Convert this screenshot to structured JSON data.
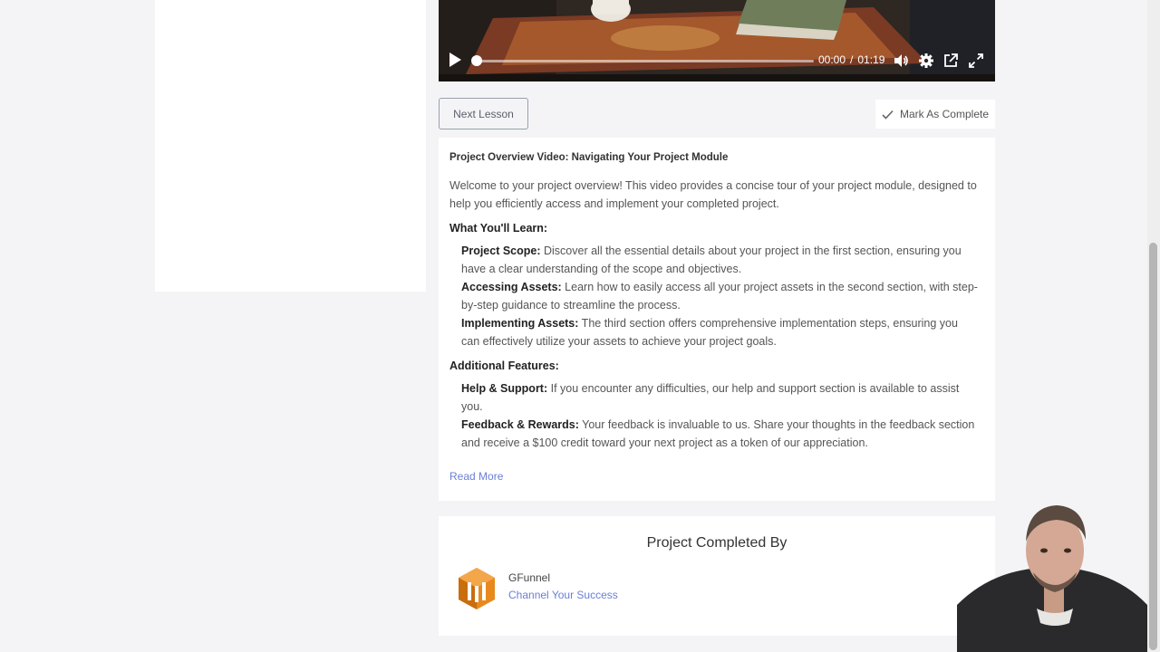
{
  "video": {
    "current_time": "00:00",
    "separator": "/",
    "duration": "01:19",
    "progress_fraction": 0.0
  },
  "lesson_nav": {
    "next_label": "Next Lesson",
    "complete_label": "Mark As Complete"
  },
  "description": {
    "title": "Project Overview Video: Navigating Your Project Module",
    "intro": "Welcome to your project overview! This video provides a concise tour of your project module, designed to help you efficiently access and implement your completed project.",
    "learn_heading": "What You'll Learn:",
    "learn_items": [
      {
        "label": "Project Scope:",
        "text": " Discover all the essential details about your project in the first section, ensuring you have a clear understanding of the scope and objectives."
      },
      {
        "label": "Accessing Assets:",
        "text": " Learn how to easily access all your project assets in the second section, with step-by-step guidance to streamline the process."
      },
      {
        "label": "Implementing Assets:",
        "text": " The third section offers comprehensive implementation steps, ensuring you can effectively utilize your assets to achieve your project goals."
      }
    ],
    "features_heading": "Additional Features:",
    "feature_items": [
      {
        "label": "Help & Support:",
        "text": " If you encounter any difficulties, our help and support section is available to assist you."
      },
      {
        "label": "Feedback & Rewards:",
        "text": " Your feedback is invaluable to us. Share your thoughts in the feedback section and receive a $100 credit toward your next project as a token of our appreciation."
      }
    ],
    "read_more": "Read More"
  },
  "completed_by": {
    "heading": "Project Completed By",
    "name": "GFunnel",
    "tagline": "Channel Your Success",
    "logo_color": "#e8891d"
  },
  "colors": {
    "accent_link": "#6a7fd6",
    "page_bg": "#f4f4f6"
  }
}
